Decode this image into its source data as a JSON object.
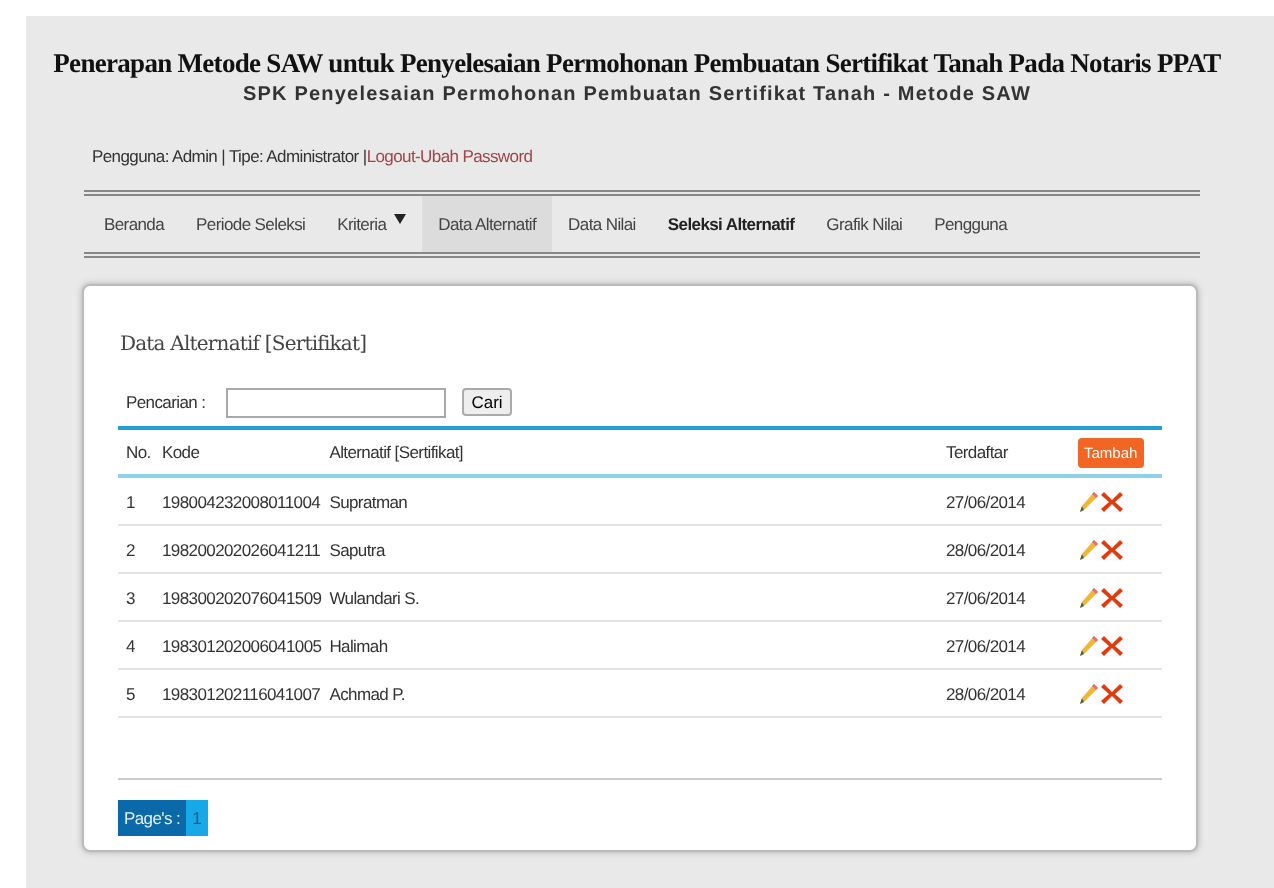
{
  "header": {
    "title": "Penerapan Metode SAW untuk Penyelesaian Permohonan Pembuatan Sertifikat Tanah Pada Notaris PPAT",
    "subtitle": "SPK Penyelesaian Permohonan Pembuatan Sertifikat Tanah - Metode SAW"
  },
  "user_bar": {
    "info": "Pengguna: Admin | Tipe: Administrator |",
    "logout": "Logout",
    "separator": "-",
    "change_password": "Ubah Password"
  },
  "nav": [
    {
      "label": "Beranda",
      "selected": false,
      "bold": false,
      "dropdown": false
    },
    {
      "label": "Periode Seleksi",
      "selected": false,
      "bold": false,
      "dropdown": false
    },
    {
      "label": "Kriteria",
      "selected": false,
      "bold": false,
      "dropdown": true
    },
    {
      "label": "Data Alternatif",
      "selected": true,
      "bold": false,
      "dropdown": false
    },
    {
      "label": "Data Nilai",
      "selected": false,
      "bold": false,
      "dropdown": false
    },
    {
      "label": "Seleksi Alternatif",
      "selected": false,
      "bold": true,
      "dropdown": false
    },
    {
      "label": "Grafik Nilai",
      "selected": false,
      "bold": false,
      "dropdown": false
    },
    {
      "label": "Pengguna",
      "selected": false,
      "bold": false,
      "dropdown": false
    }
  ],
  "panel": {
    "title": "Data Alternatif [Sertifikat]",
    "search_label": "Pencarian :",
    "search_button": "Cari",
    "add_button": "Tambah"
  },
  "table": {
    "columns": [
      "No.",
      "Kode",
      "Alternatif [Sertifikat]",
      "Terdaftar"
    ],
    "rows": [
      [
        "1",
        "198004232008011004",
        "Supratman",
        "27/06/2014"
      ],
      [
        "2",
        "198200202026041211",
        "Saputra",
        "28/06/2014"
      ],
      [
        "3",
        "198300202076041509",
        "Wulandari S.",
        "27/06/2014"
      ],
      [
        "4",
        "198301202006041005",
        "Halimah",
        "27/06/2014"
      ],
      [
        "5",
        "198301202116041007",
        "Achmad P.",
        "28/06/2014"
      ]
    ]
  },
  "pager": {
    "label": "Page's :",
    "pages": [
      "1"
    ]
  }
}
